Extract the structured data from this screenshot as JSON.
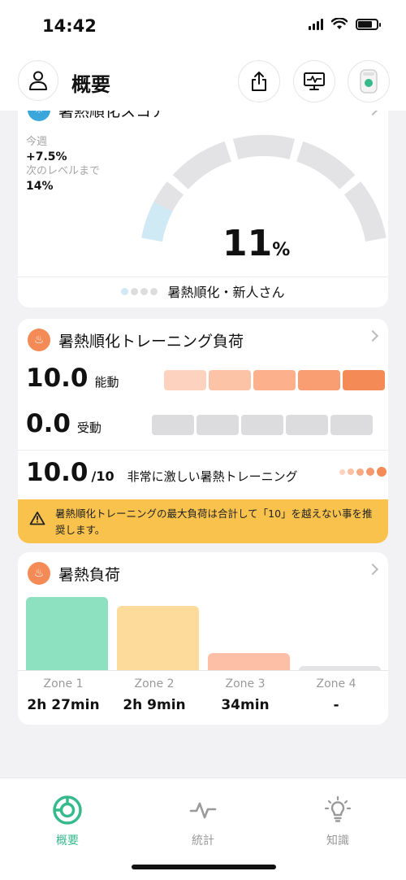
{
  "status_bar": {
    "time": "14:42"
  },
  "header": {
    "title": "概要"
  },
  "acclimation": {
    "title_partial": "暑熱順化スコア",
    "this_week_label": "今週",
    "this_week_value": "+7.5%",
    "next_level_label": "次のレベルまで",
    "next_level_value": "14%",
    "score_number": "11",
    "score_unit": "%",
    "score_progress": 0.11,
    "level_text": "暑熱順化・新人さん"
  },
  "training": {
    "title": "暑熱順化トレーニング負荷",
    "active_value": "10.0",
    "active_label": "能動",
    "passive_value": "0.0",
    "passive_label": "受動",
    "total_value": "10.0",
    "total_unit": "/10",
    "total_label": "非常に激しい暑熱トレーニング",
    "warning": "暑熱順化トレーニングの最大負荷は合計して「10」を越えない事を推奨します。",
    "active_bar_colors": [
      "#fdd3bf",
      "#fdc3a7",
      "#fcb08c",
      "#f99d73",
      "#f48a55"
    ],
    "passive_bar_color": "#dcdcdf"
  },
  "heat_load": {
    "title": "暑熱負荷",
    "zones": [
      {
        "label": "Zone 1",
        "value": "2h 27min",
        "fraction": 1.0,
        "color": "#8de0c0"
      },
      {
        "label": "Zone 2",
        "value": "2h 9min",
        "fraction": 0.88,
        "color": "#fddb9a"
      },
      {
        "label": "Zone 3",
        "value": "34min",
        "fraction": 0.23,
        "color": "#fdc0a6"
      },
      {
        "label": "Zone 4",
        "value": "-",
        "fraction": 0.06,
        "color": "#e3e3e5"
      }
    ]
  },
  "tabs": [
    {
      "label": "概要",
      "active": true
    },
    {
      "label": "統計",
      "active": false
    },
    {
      "label": "知識",
      "active": false
    }
  ],
  "colors": {
    "accent": "#36b98b",
    "gauge_track": "#e3e3e5",
    "gauge_fill": "#cfe9f5",
    "warning": "#f8c24d"
  }
}
